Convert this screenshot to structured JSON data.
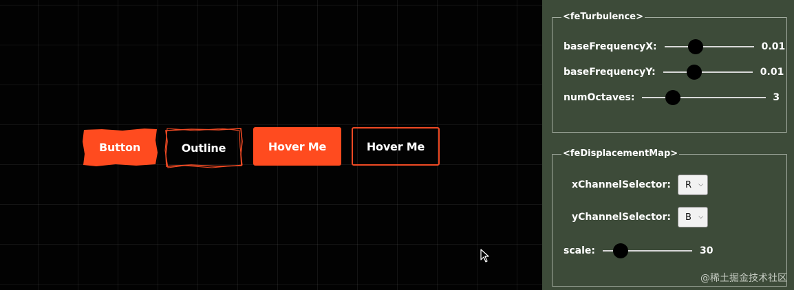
{
  "stage": {
    "buttons": [
      {
        "label": "Button",
        "style": "filled-rough",
        "color": "#ff4b1f"
      },
      {
        "label": "Outline",
        "style": "outline-rough",
        "color": "#f04a24"
      },
      {
        "label": "Hover Me",
        "style": "filled",
        "color": "#ff4b1f"
      },
      {
        "label": "Hover Me",
        "style": "outline",
        "color": "#f04a24"
      }
    ],
    "cursor_icon": "arrow-cursor"
  },
  "panel": {
    "turbulence": {
      "legend": "<feTurbulence>",
      "controls": [
        {
          "label": "baseFrequencyX:",
          "value": "0.01",
          "level": 0.35
        },
        {
          "label": "baseFrequencyY:",
          "value": "0.01",
          "level": 0.35
        },
        {
          "label": "numOctaves:",
          "value": "3",
          "level": 0.25
        }
      ]
    },
    "displacement": {
      "legend": "<feDisplacementMap>",
      "x_selector": {
        "label": "xChannelSelector:",
        "value": "R"
      },
      "y_selector": {
        "label": "yChannelSelector:",
        "value": "B"
      },
      "scale": {
        "label": "scale:",
        "value": "30",
        "level": 0.2
      }
    }
  },
  "watermark": "@稀土掘金技术社区",
  "colors": {
    "accent": "#ff4b1f",
    "panel_bg": "#3d4b39",
    "stage_bg": "#020202"
  }
}
